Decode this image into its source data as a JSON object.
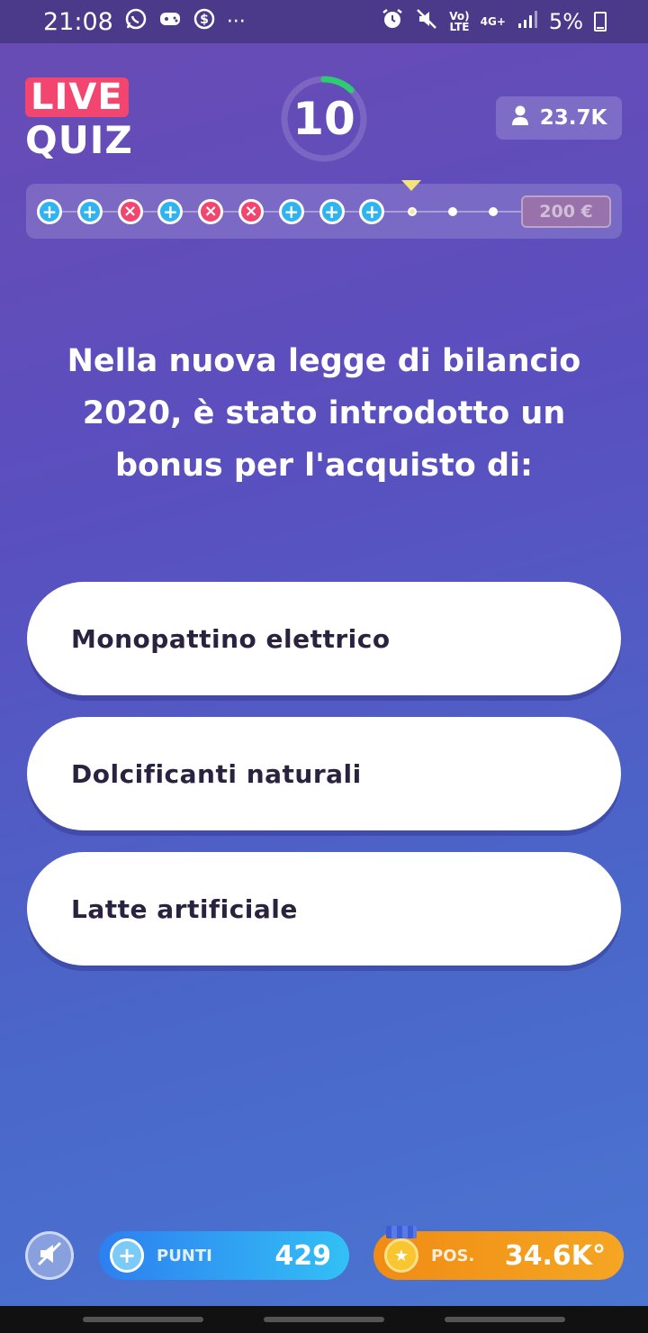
{
  "status_bar": {
    "time": "21:08",
    "volte_label": "Vo)\nLTE",
    "network_label": "4G+",
    "battery": "5%"
  },
  "header": {
    "logo_live": "LIVE",
    "logo_quiz": "QUIZ",
    "timer": "10",
    "timer_fraction_remaining": 0.12,
    "viewers": "23.7K"
  },
  "progress": {
    "steps": [
      "ok",
      "ok",
      "ko",
      "ok",
      "ko",
      "ko",
      "ok",
      "ok",
      "ok",
      "current",
      "pending",
      "pending"
    ],
    "prize": "200 €"
  },
  "question": {
    "text": "Nella nuova legge di bilancio 2020, è stato introdotto un bonus per l'acquisto di:"
  },
  "answers": [
    {
      "label": "Monopattino elettrico"
    },
    {
      "label": "Dolcificanti naturali"
    },
    {
      "label": "Latte artificiale"
    }
  ],
  "bottom": {
    "points_label": "PUNTI",
    "points_value": "429",
    "position_label": "POS.",
    "position_value": "34.6K°"
  },
  "colors": {
    "accent_pink": "#f2456f",
    "accent_blue": "#2fb4ef",
    "timer_green": "#2ecc71",
    "marker_yellow": "#f6e27a"
  }
}
